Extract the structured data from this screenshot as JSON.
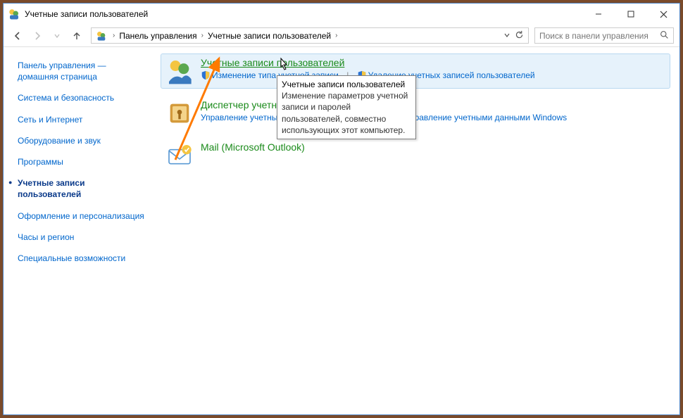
{
  "titlebar": {
    "title": "Учетные записи пользователей"
  },
  "nav": {
    "breadcrumb": [
      "Панель управления",
      "Учетные записи пользователей"
    ],
    "search_placeholder": "Поиск в панели управления"
  },
  "sidebar": {
    "items": [
      {
        "label": "Панель управления — домашняя страница",
        "current": false
      },
      {
        "label": "Система и безопасность",
        "current": false
      },
      {
        "label": "Сеть и Интернет",
        "current": false
      },
      {
        "label": "Оборудование и звук",
        "current": false
      },
      {
        "label": "Программы",
        "current": false
      },
      {
        "label": "Учетные записи пользователей",
        "current": true
      },
      {
        "label": "Оформление и персонализация",
        "current": false
      },
      {
        "label": "Часы и регион",
        "current": false
      },
      {
        "label": "Специальные возможности",
        "current": false
      }
    ]
  },
  "content": {
    "categories": [
      {
        "title": "Учетные записи пользователей",
        "hover": true,
        "sub": [
          {
            "shield": true,
            "label": "Изменение типа учетной записи"
          },
          {
            "shield": true,
            "label": "Удаление учетных записей пользователей"
          }
        ]
      },
      {
        "title": "Диспетчер учетных данных",
        "hover": false,
        "sub": [
          {
            "shield": false,
            "label": "Управление учетными данными для Интернета"
          },
          {
            "shield": false,
            "label": "Управление учетными данными Windows"
          }
        ]
      },
      {
        "title": "Mail (Microsoft Outlook)",
        "hover": false,
        "sub": []
      }
    ]
  },
  "tooltip": {
    "title": "Учетные записи пользователей",
    "body": "Изменение параметров учетной записи и паролей пользователей, совместно использующих этот компьютер."
  }
}
